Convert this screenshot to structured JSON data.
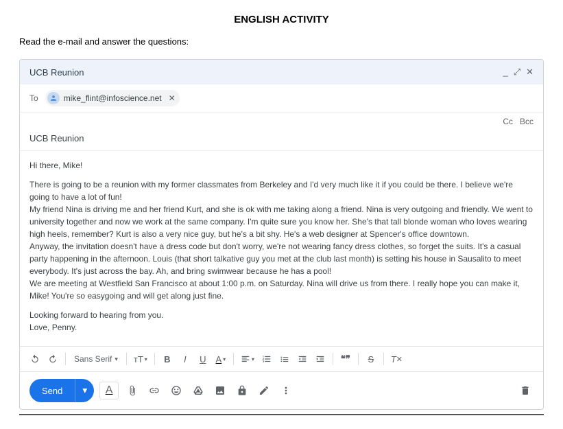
{
  "page": {
    "title": "ENGLISH ACTIVITY",
    "instruction": "Read the e-mail and answer the questions:"
  },
  "compose": {
    "subject_header": "UCB Reunion",
    "to_label": "To",
    "recipient": "mike_flint@infoscience.net",
    "cc_label": "Cc",
    "bcc_label": "Bcc",
    "subject_line": "UCB Reunion",
    "body": {
      "greeting": "Hi there, Mike!",
      "p1": "There is going to be a reunion with my former classmates from Berkeley and I'd very much like it if you could be there. I believe we're going to have a lot of fun!",
      "p2": "My friend Nina is driving me and her friend Kurt, and she is ok with me taking along a friend. Nina is very outgoing and friendly. We went to university together and now we work at the same company. I'm quite sure you know her. She's that tall blonde woman who loves wearing high heels, remember? Kurt is also a very nice guy, but he's a bit shy. He's a web designer at Spencer's office downtown.",
      "p3": "Anyway, the invitation doesn't have a dress code but don't worry, we're not wearing fancy dress clothes, so forget the suits. It's a casual party happening in the afternoon. Louis (that short talkative guy you met at the club last month) is setting his house in Sausalito to meet everybody. It's just across the bay.  Ah, and bring swimwear because he has a pool!",
      "p4": "We are meeting at Westfield San Francisco at about 1:00 p.m. on Saturday. Nina will drive us from there. I really hope you can make it, Mike! You're so easygoing and will get along just fine.",
      "closing1": "Looking forward to hearing from you.",
      "closing2": "Love, Penny."
    }
  },
  "toolbar": {
    "font": "Sans Serif",
    "send_label": "Send"
  }
}
